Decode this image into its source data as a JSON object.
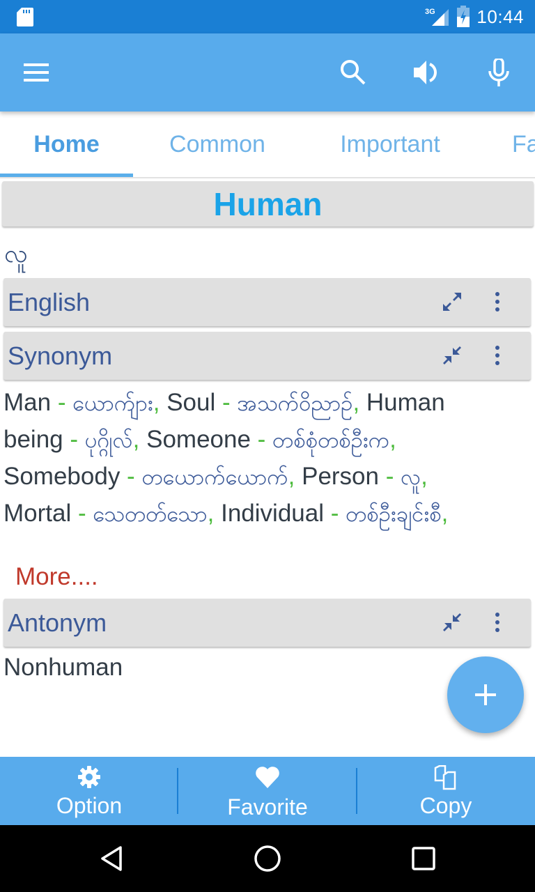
{
  "status_bar": {
    "time": "10:44",
    "network": "3G",
    "icons": [
      "sd-card-icon",
      "signal-3g-icon",
      "battery-charging-icon"
    ]
  },
  "app_bar": {
    "icons": [
      "menu-icon",
      "search-icon",
      "speaker-icon",
      "microphone-icon"
    ]
  },
  "tabs": [
    {
      "label": "Home",
      "active": true
    },
    {
      "label": "Common",
      "active": false
    },
    {
      "label": "Important",
      "active": false
    },
    {
      "label": "Favorite",
      "active": false
    }
  ],
  "word": {
    "english": "Human",
    "myanmar": "လူ"
  },
  "sections": {
    "english": {
      "label": "English",
      "state": "collapsed",
      "expand_icon": "expand-icon"
    },
    "synonym": {
      "label": "Synonym",
      "state": "expanded",
      "expand_icon": "collapse-icon"
    },
    "antonym": {
      "label": "Antonym",
      "state": "expanded",
      "expand_icon": "collapse-icon"
    }
  },
  "synonyms": [
    {
      "en": "Man",
      "my": "ယောက်ျား"
    },
    {
      "en": "Soul",
      "my": "အသက်ဝိညာဉ်"
    },
    {
      "en": "Human being",
      "my": "ပုဂ္ဂိုလ်"
    },
    {
      "en": "Someone",
      "my": "တစ်စုံတစ်ဦးက"
    },
    {
      "en": "Somebody",
      "my": "တယောက်ယောက်"
    },
    {
      "en": "Person",
      "my": "လူ"
    },
    {
      "en": "Mortal",
      "my": "သေတတ်သော"
    },
    {
      "en": "Individual",
      "my": "တစ်ဦးချင်းစီ"
    }
  ],
  "separator": " - ",
  "comma": ", ",
  "more_link": "More....",
  "antonyms": [
    "Nonhuman"
  ],
  "fab": {
    "icon": "plus-icon"
  },
  "bottom_bar": [
    {
      "label": "Option",
      "icon": "gear-icon"
    },
    {
      "label": "Favorite",
      "icon": "heart-icon"
    },
    {
      "label": "Copy",
      "icon": "copy-icon"
    }
  ],
  "nav_bar": [
    "back-icon",
    "home-icon",
    "recents-icon"
  ],
  "colors": {
    "status_bar": "#1a7fd4",
    "app_bar": "#58abec",
    "tab_active": "#4a9de0",
    "word_title": "#1aa3e8",
    "section_label": "#3b5998",
    "separator": "#4cbb3c",
    "more_link": "#c0392b"
  }
}
